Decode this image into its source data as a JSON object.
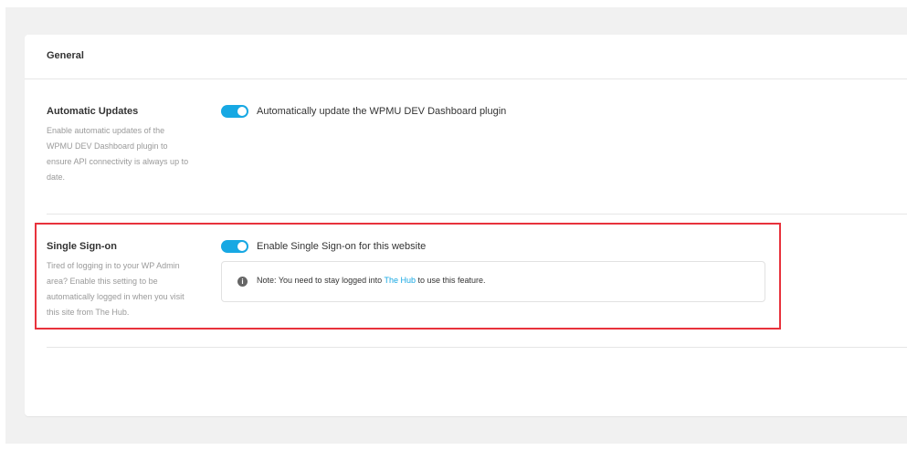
{
  "card": {
    "title": "General"
  },
  "automatic_updates": {
    "label": "Automatic Updates",
    "description": "Enable automatic updates of the WPMU DEV Dashboard plugin to ensure API connectivity is always up to date.",
    "toggle_on": true,
    "toggle_label": "Automatically update the WPMU DEV Dashboard plugin"
  },
  "single_sign_on": {
    "label": "Single Sign-on",
    "description": "Tired of logging in to your WP Admin area? Enable this setting to be automatically logged in when you visit this site from The Hub.",
    "toggle_on": true,
    "toggle_label": "Enable Single Sign-on for this website",
    "notice": {
      "icon": "info-icon",
      "prefix": "Note: You need to stay logged into ",
      "link_text": "The Hub",
      "suffix": " to use this feature."
    }
  },
  "colors": {
    "accent": "#17a8e3",
    "highlight": "#e8323c",
    "background": "#f1f1f1"
  }
}
